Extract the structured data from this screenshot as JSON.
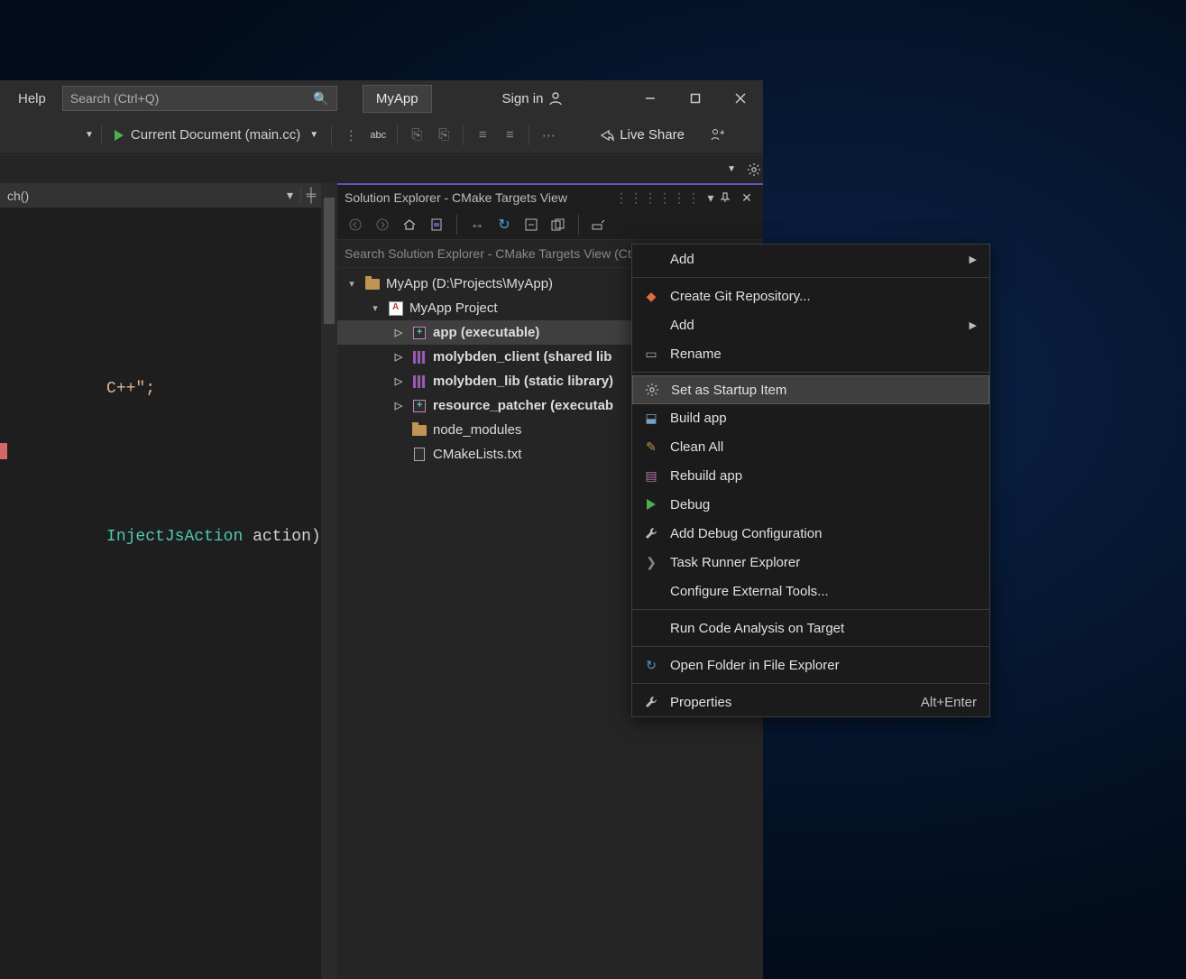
{
  "menu": {
    "help": "Help"
  },
  "search": {
    "placeholder": "Search (Ctrl+Q)"
  },
  "title_tab": "MyApp",
  "signin": "Sign in",
  "debug_target": "Current Document (main.cc)",
  "live_share": "Live Share",
  "code": {
    "header_combo": "ch()",
    "line_cpp": "C++\";",
    "line_fn_type": "InjectJsAction",
    "line_fn_rest": " action) {"
  },
  "se": {
    "title": "Solution Explorer - CMake Targets View",
    "search_placeholder": "Search Solution Explorer - CMake Targets View (Ctrl+;)",
    "tree": [
      {
        "depth": 0,
        "twist": "down",
        "icon": "folder",
        "label": "MyApp (D:\\Projects\\MyApp)"
      },
      {
        "depth": 1,
        "twist": "down",
        "icon": "proj",
        "label": "MyApp Project"
      },
      {
        "depth": 2,
        "twist": "right",
        "icon": "target",
        "label": "app (executable)",
        "bold": true,
        "selected": true
      },
      {
        "depth": 2,
        "twist": "right",
        "icon": "lib",
        "label": "molybden_client (shared lib",
        "bold": true
      },
      {
        "depth": 2,
        "twist": "right",
        "icon": "lib",
        "label": "molybden_lib (static library)",
        "bold": true
      },
      {
        "depth": 2,
        "twist": "right",
        "icon": "target",
        "label": "resource_patcher (executab",
        "bold": true
      },
      {
        "depth": 2,
        "twist": "none",
        "icon": "folder",
        "label": "node_modules"
      },
      {
        "depth": 2,
        "twist": "none",
        "icon": "file",
        "label": "CMakeLists.txt"
      }
    ]
  },
  "context_menu": [
    {
      "label": "Add",
      "submenu": true
    },
    {
      "sep": true
    },
    {
      "label": "Create Git Repository...",
      "icon": "git"
    },
    {
      "label": "Add",
      "submenu": true
    },
    {
      "label": "Rename",
      "icon": "rename"
    },
    {
      "sep": true
    },
    {
      "label": "Set as Startup Item",
      "icon": "gear",
      "hover": true
    },
    {
      "label": "Build app",
      "icon": "build"
    },
    {
      "label": "Clean All",
      "icon": "clean"
    },
    {
      "label": "Rebuild app",
      "icon": "rebuild"
    },
    {
      "label": "Debug",
      "icon": "play"
    },
    {
      "label": "Add Debug Configuration",
      "icon": "wrench"
    },
    {
      "label": "Task Runner Explorer",
      "icon": "chev"
    },
    {
      "label": "Configure External Tools..."
    },
    {
      "sep": true
    },
    {
      "label": "Run Code Analysis on Target"
    },
    {
      "sep": true
    },
    {
      "label": "Open Folder in File Explorer",
      "icon": "open"
    },
    {
      "sep": true
    },
    {
      "label": "Properties",
      "icon": "wrench",
      "shortcut": "Alt+Enter"
    }
  ]
}
